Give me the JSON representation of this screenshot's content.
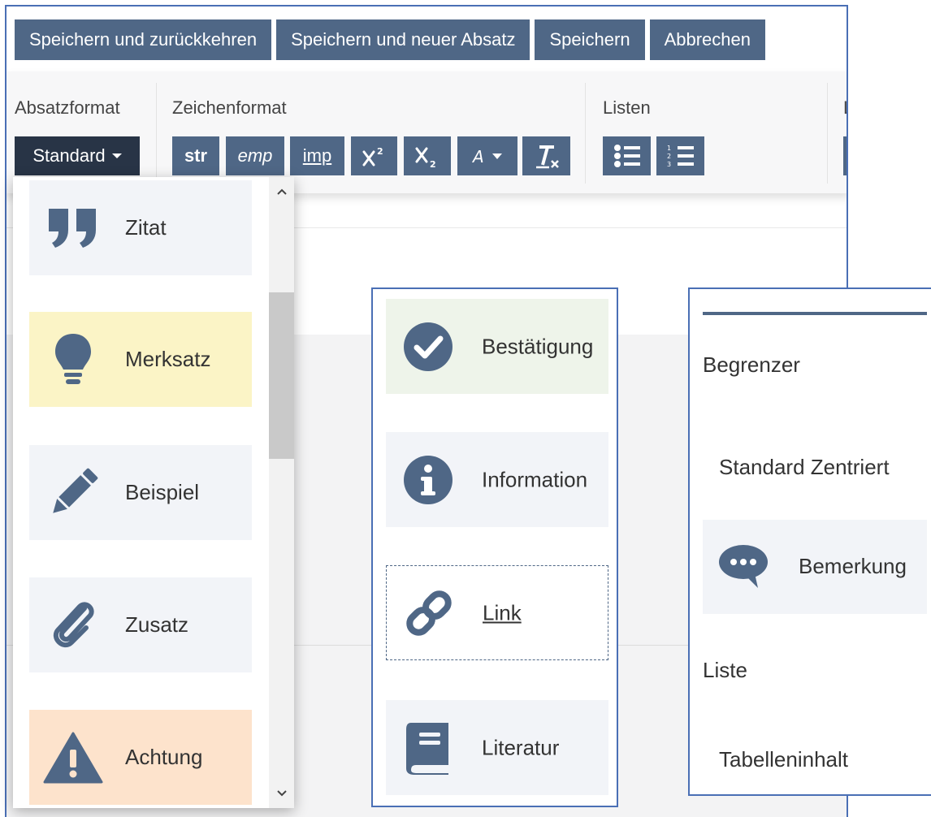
{
  "actions": {
    "save_return": "Speichern und zurückkehren",
    "save_new_paragraph": "Speichern und neuer Absatz",
    "save": "Speichern",
    "cancel": "Abbrechen"
  },
  "ribbon": {
    "paragraph_group_label": "Absatzformat",
    "character_group_label": "Zeichenformat",
    "lists_group_label": "Listen",
    "cut_group_label": "L",
    "paragraph_dropdown_value": "Standard",
    "character_buttons": {
      "strong": "str",
      "emphasis": "emp",
      "important": "imp"
    }
  },
  "paragraph_menu": {
    "items": [
      {
        "label": "Zitat",
        "icon": "quote-icon",
        "bg": "#f2f4f8"
      },
      {
        "label": "Merksatz",
        "icon": "lightbulb-icon",
        "bg": "#fbf4c6"
      },
      {
        "label": "Beispiel",
        "icon": "pencil-icon",
        "bg": "#f2f4f8"
      },
      {
        "label": "Zusatz",
        "icon": "paperclip-icon",
        "bg": "#f2f4f8"
      },
      {
        "label": "Achtung",
        "icon": "warning-icon",
        "bg": "#fde3cc"
      }
    ]
  },
  "panel_middle": {
    "items": [
      {
        "label": "Bestätigung",
        "icon": "check-circle-icon",
        "bg": "#eef4ea"
      },
      {
        "label": "Information",
        "icon": "info-circle-icon",
        "bg": "#f2f4f8"
      },
      {
        "label": "Link",
        "icon": "link-icon",
        "bg": "#ffffff"
      },
      {
        "label": "Literatur",
        "icon": "book-icon",
        "bg": "#f2f4f8"
      }
    ]
  },
  "panel_right": {
    "begrenzer": "Begrenzer",
    "standard_centered": "Standard Zentriert",
    "bemerkung": "Bemerkung",
    "liste": "Liste",
    "tabelleninhalt": "Tabelleninhalt"
  },
  "colors": {
    "button_bg": "#4f6786",
    "dropdown_bg": "#283446",
    "icon": "#4f6786",
    "frame_border": "#4a6fb5"
  }
}
